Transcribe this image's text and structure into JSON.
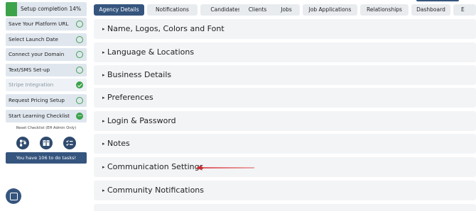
{
  "sidebar": {
    "setup_completion": "Setup completion 14%",
    "setup_progress": 0.14,
    "checklist": [
      {
        "label": "Save Your Platform URL",
        "status": "pending"
      },
      {
        "label": "Select Launch Date",
        "status": "pending"
      },
      {
        "label": "Connect your Domain",
        "status": "pending"
      },
      {
        "label": "Text/SMS Set-up",
        "status": "pending"
      },
      {
        "label": "Stripe Integration",
        "status": "completed"
      },
      {
        "label": "Request Pricing Setup",
        "status": "pending"
      },
      {
        "label": "Start Learning Checklist",
        "status": "in-progress"
      }
    ],
    "reset_checklist": "Reset Checklist (EH Admin Only)",
    "icons": [
      "flow-icon",
      "book-icon",
      "checklist-icon"
    ],
    "tasks_button": "You have 106 to do tasks!",
    "chat_icon": "chat-icon"
  },
  "tabs": [
    {
      "label": "Agency Details",
      "active": true
    },
    {
      "label": "Notifications",
      "active": false
    },
    {
      "label": "Candidates",
      "active": false
    },
    {
      "label": "Clients",
      "active": false
    },
    {
      "label": "Jobs",
      "active": false
    },
    {
      "label": "Job Applications",
      "active": false
    },
    {
      "label": "Relationships",
      "active": false
    },
    {
      "label": "Dashboard",
      "active": false
    },
    {
      "label": "E",
      "active": false
    }
  ],
  "sections": [
    {
      "label": "Name, Logos, Colors and Font"
    },
    {
      "label": "Language & Locations"
    },
    {
      "label": "Business Details"
    },
    {
      "label": "Preferences"
    },
    {
      "label": "Login & Password"
    },
    {
      "label": "Notes"
    },
    {
      "label": "Communication Settings"
    },
    {
      "label": "Community Notifications"
    }
  ],
  "colors": {
    "accent": "#35557e",
    "success": "#3da34a",
    "annotation_arrow": "#d9262b"
  }
}
